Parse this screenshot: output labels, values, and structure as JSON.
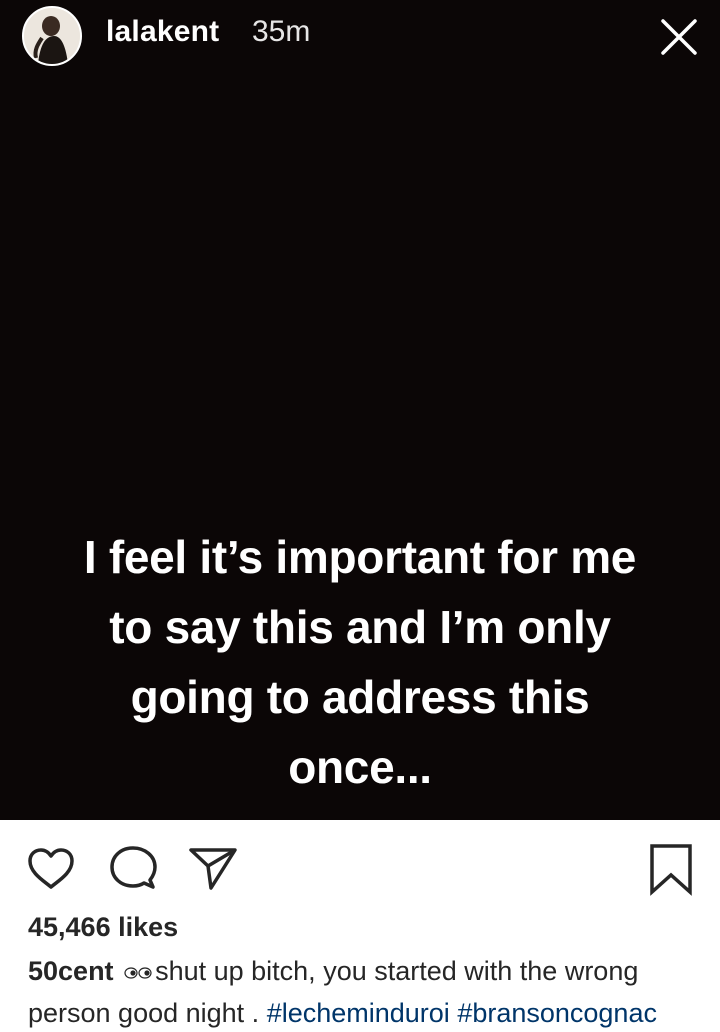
{
  "story": {
    "username": "lalakent",
    "time_ago": "35m",
    "text_lines": [
      "I feel it’s important for me",
      "to say this and I’m only",
      "going to address this",
      "once..."
    ],
    "background_color": "#0b0606"
  },
  "post": {
    "likes": "45,466 likes",
    "caption": {
      "author": "50cent",
      "emoji_icon": "eyes-emoji-icon",
      "text_part1": "shut up bitch, ",
      "glyph": "",
      "text_part2": "you started with the wrong person good night . ",
      "hashtag1": "#lecheminduroi",
      "hashtag2": "#bransoncognac"
    },
    "link_color": "#003569"
  },
  "icons": [
    "heart-icon",
    "comment-icon",
    "share-icon",
    "bookmark-icon",
    "close-icon"
  ]
}
